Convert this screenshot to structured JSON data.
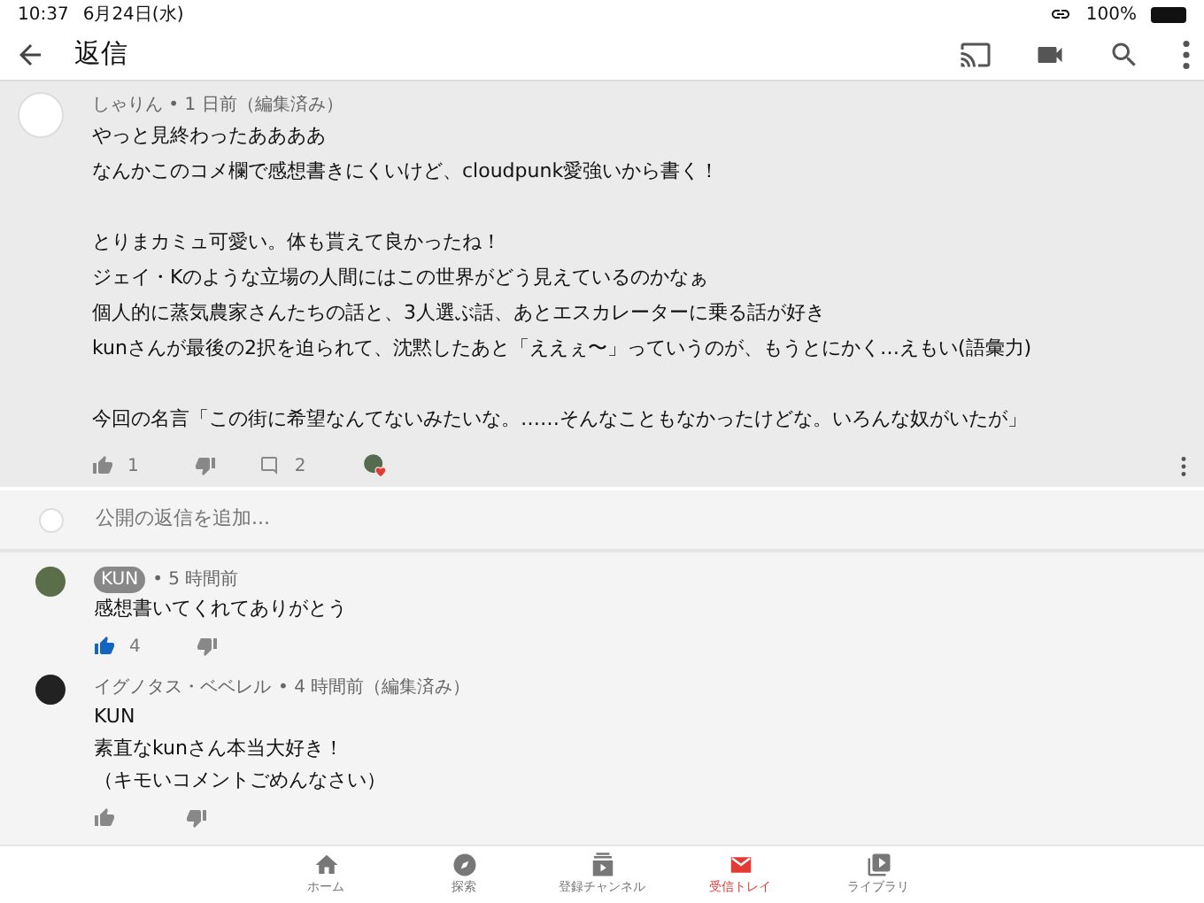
{
  "status_bar": {
    "time": "10:37",
    "date": "6月24日(水)",
    "battery": "100%"
  },
  "app_bar": {
    "title": "返信"
  },
  "comment": {
    "header": "しゃりん • 1 日前（編集済み）",
    "paragraphs": [
      [
        "やっと見終わったああああ",
        "なんかこのコメ欄で感想書きにくいけど、cloudpunk愛強いから書く！"
      ],
      [
        "とりまカミュ可愛い。体も貰えて良かったね！",
        "ジェイ・Kのような立場の人間にはこの世界がどう見えているのかなぁ",
        "個人的に蒸気農家さんたちの話と、3人選ぶ話、あとエスカレーターに乗る話が好き",
        "kunさんが最後の2択を迫られて、沈黙したあと「ええぇ〜」っていうのが、もうとにかく…えもい(語彙力)"
      ],
      [
        "今回の名言「この街に希望なんてないみたいな。……そんなこともなかったけどな。いろんな奴がいたが」"
      ]
    ],
    "likes": "1",
    "liked": false,
    "reply_count": "2",
    "hearted": true
  },
  "reply_box": {
    "placeholder": "公開の返信を追加..."
  },
  "replies": [
    {
      "author": "KUN",
      "owner": true,
      "meta": "• 5 時間前",
      "lines": [
        "感想書いてくれてありがとう"
      ],
      "likes": "4",
      "liked": true
    },
    {
      "author": "イグノタス・ベベレル",
      "owner": false,
      "meta": "• 4 時間前（編集済み）",
      "lines": [
        "KUN",
        "素直なkunさん本当大好き！",
        "（キモいコメントごめんなさい）"
      ],
      "liked": false
    }
  ],
  "nav": [
    {
      "kind": "home",
      "label": "ホーム",
      "selected": false
    },
    {
      "kind": "explore",
      "label": "探索",
      "selected": false
    },
    {
      "kind": "subscriptions",
      "label": "登録チャンネル",
      "selected": false
    },
    {
      "kind": "inbox",
      "label": "受信トレイ",
      "selected": true
    },
    {
      "kind": "library",
      "label": "ライブラリ",
      "selected": false
    }
  ]
}
